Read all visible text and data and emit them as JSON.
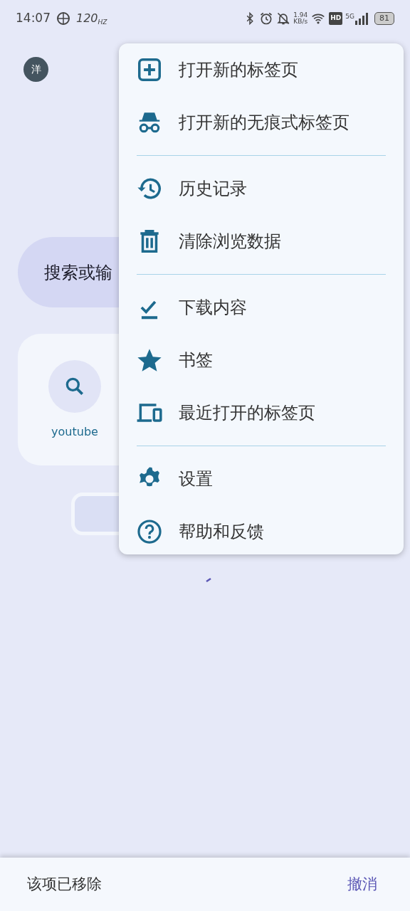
{
  "status_bar": {
    "time": "14:07",
    "refresh_rate": "120",
    "refresh_unit": "HZ",
    "net_speed": "1.94",
    "net_unit": "KB/s",
    "hd": "HD",
    "network": "5G",
    "battery": "81"
  },
  "avatar": {
    "initial": "洋"
  },
  "search": {
    "placeholder": "搜索或输"
  },
  "shortcuts": [
    {
      "label": "youtube"
    }
  ],
  "menu": {
    "sections": [
      [
        {
          "label": "打开新的标签页"
        },
        {
          "label": "打开新的无痕式标签页"
        }
      ],
      [
        {
          "label": "历史记录"
        },
        {
          "label": "清除浏览数据"
        }
      ],
      [
        {
          "label": "下载内容"
        },
        {
          "label": "书签"
        },
        {
          "label": "最近打开的标签页"
        }
      ],
      [
        {
          "label": "设置"
        },
        {
          "label": "帮助和反馈"
        }
      ]
    ]
  },
  "snackbar": {
    "message": "该项已移除",
    "action": "撤消"
  }
}
